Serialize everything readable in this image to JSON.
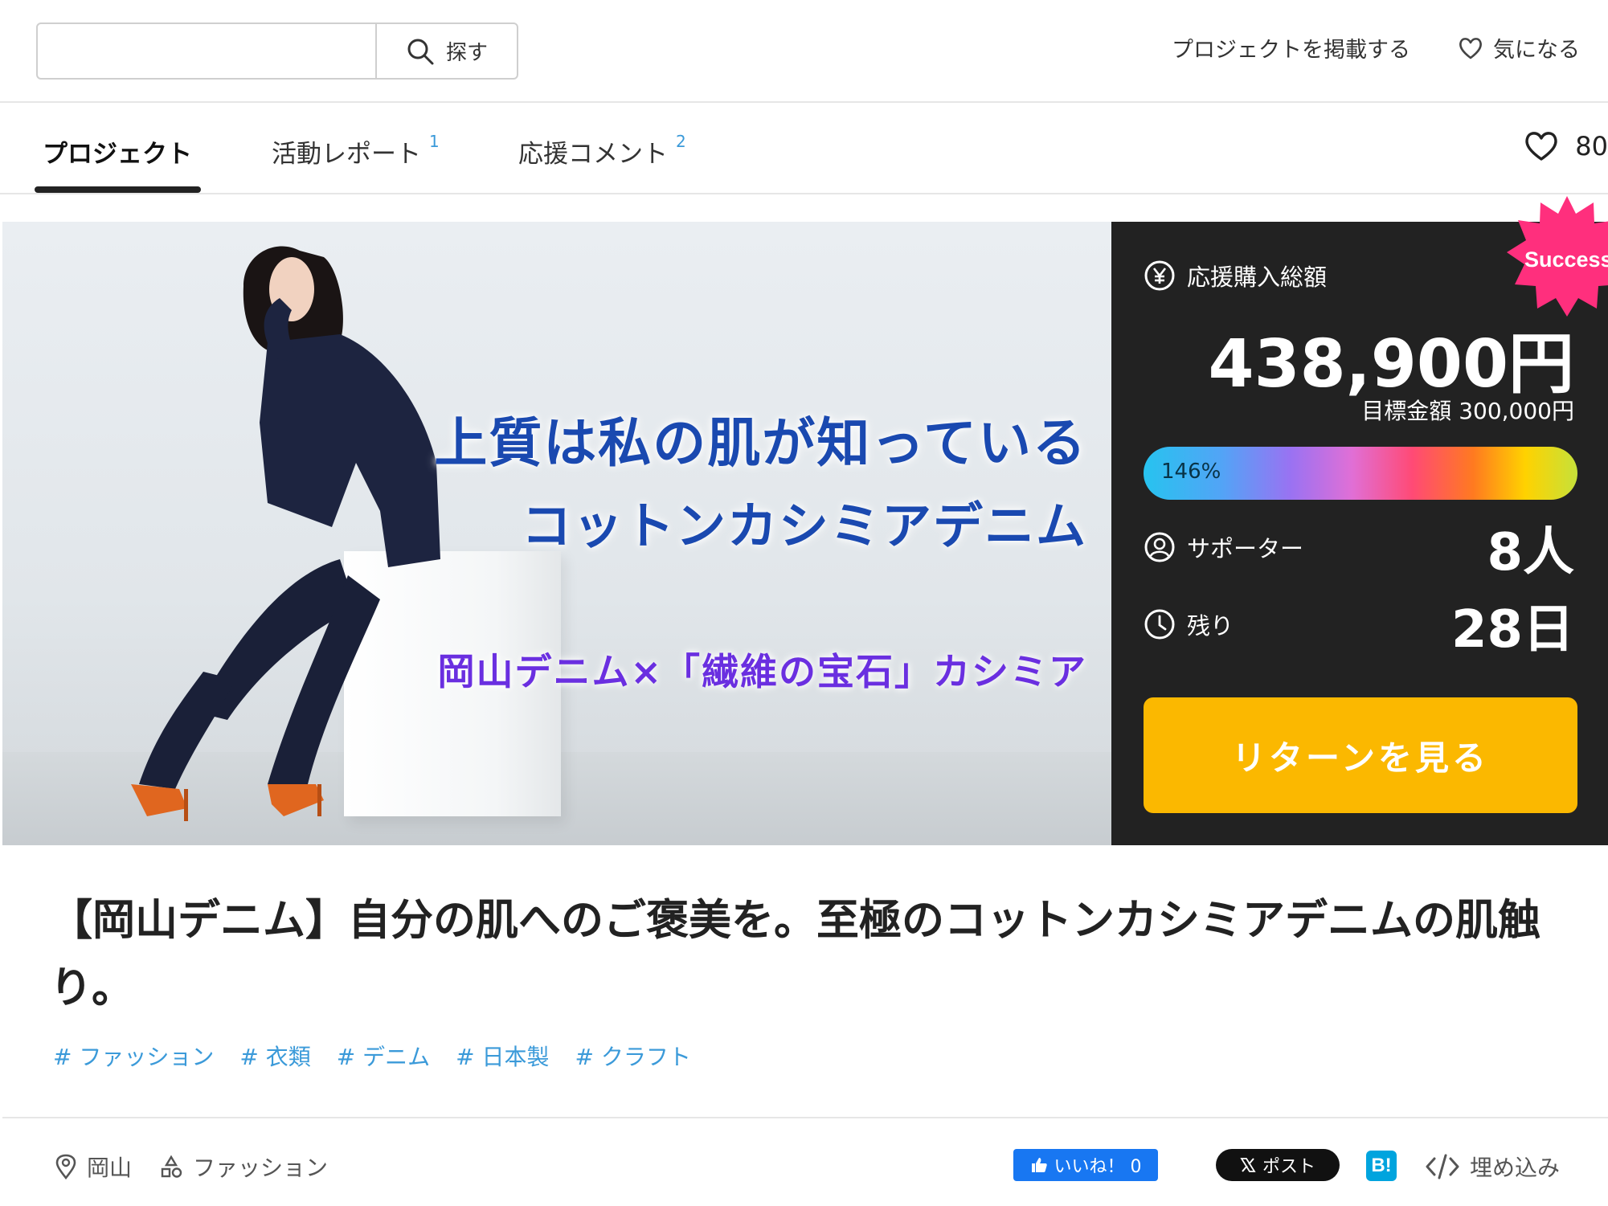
{
  "header": {
    "search_placeholder": "",
    "search_button_label": "探す",
    "post_project_link": "プロジェクトを掲載する",
    "favorite_link": "気になる"
  },
  "tabs": [
    {
      "label": "プロジェクト",
      "count": ""
    },
    {
      "label": "活動レポート",
      "count": "1"
    },
    {
      "label": "応援コメント",
      "count": "2"
    }
  ],
  "like_count": "80",
  "hero": {
    "line1": "上質は私の肌が知っている",
    "line2": "コットンカシミアデニム",
    "line3": "岡山デニム×「繊維の宝石」カシミア"
  },
  "stats": {
    "badge": "Success",
    "total_label": "応援購入総額",
    "total_amount": "438,900円",
    "goal_label": "目標金額 300,000円",
    "progress_label": "146%",
    "progress_percent": 146,
    "supporters_label": "サポーター",
    "supporters_value": "8人",
    "remaining_label": "残り",
    "remaining_value": "28日",
    "return_button": "リターンを見る"
  },
  "colors": {
    "panel_bg": "#222222",
    "return_button": "#fbb800",
    "tag_link": "#3b9ad9",
    "badge": "#ff2f7d"
  },
  "project_title": "【岡山デニム】自分の肌へのご褒美を。至極のコットンカシミアデニムの肌触り。",
  "tags": [
    "# ファッション",
    "# 衣類",
    "# デニム",
    "# 日本製",
    "# クラフト"
  ],
  "meta": {
    "location": "岡山",
    "category": "ファッション"
  },
  "share": {
    "fb_like": "いいね！ 0",
    "x_post": "ポスト",
    "hatena": "B!",
    "embed": "埋め込み"
  }
}
